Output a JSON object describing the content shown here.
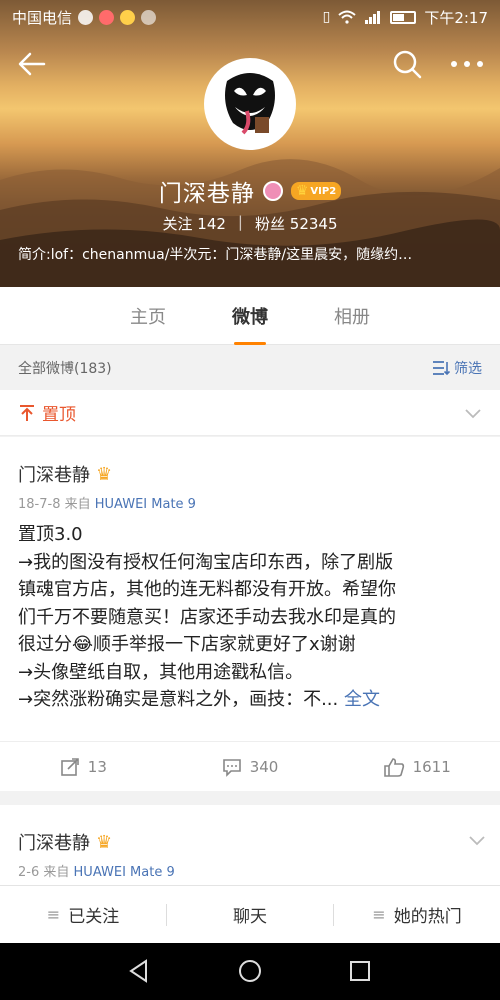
{
  "status_bar": {
    "carrier": "中国电信",
    "time": "下午2:17"
  },
  "profile": {
    "name": "门深巷静",
    "vip_label": "VIP2",
    "following_label": "关注",
    "following_count": "142",
    "followers_label": "粉丝",
    "followers_count": "52345",
    "bio": "简介:lof：chenanmua/半次元：门深巷静/这里晨安，随缘约…"
  },
  "tabs": [
    {
      "label": "主页"
    },
    {
      "label": "微博"
    },
    {
      "label": "相册"
    }
  ],
  "filter": {
    "all_posts": "全部微博(183)",
    "filter_label": "筛选"
  },
  "pinned": {
    "label": "置顶"
  },
  "posts": [
    {
      "author": "门深巷静",
      "date": "18-7-8",
      "from": "来自",
      "source": "HUAWEI Mate 9",
      "lines": [
        "置顶3.0",
        "→我的图没有授权任何淘宝店印东西，除了剧版",
        "镇魂官方店，其他的连无料都没有开放。希望你",
        "们千万不要随意买！店家还手动去我水印是真的",
        "很过分😂顺手举报一下店家就更好了x谢谢",
        "→头像壁纸自取，其他用途戳私信。",
        "→突然涨粉确实是意料之外，画技：不..."
      ],
      "full_text": "全文",
      "reposts": "13",
      "comments": "340",
      "likes": "1611"
    },
    {
      "author": "门深巷静",
      "date": "2-6",
      "from": "来自",
      "source": "HUAWEI Mate 9"
    }
  ],
  "bottom_bar": {
    "followed": "已关注",
    "chat": "聊天",
    "her_hot": "她的热门"
  },
  "colors": {
    "accent_orange": "#ff8200",
    "link_blue": "#4a74b5",
    "pin_red": "#e9572e"
  }
}
